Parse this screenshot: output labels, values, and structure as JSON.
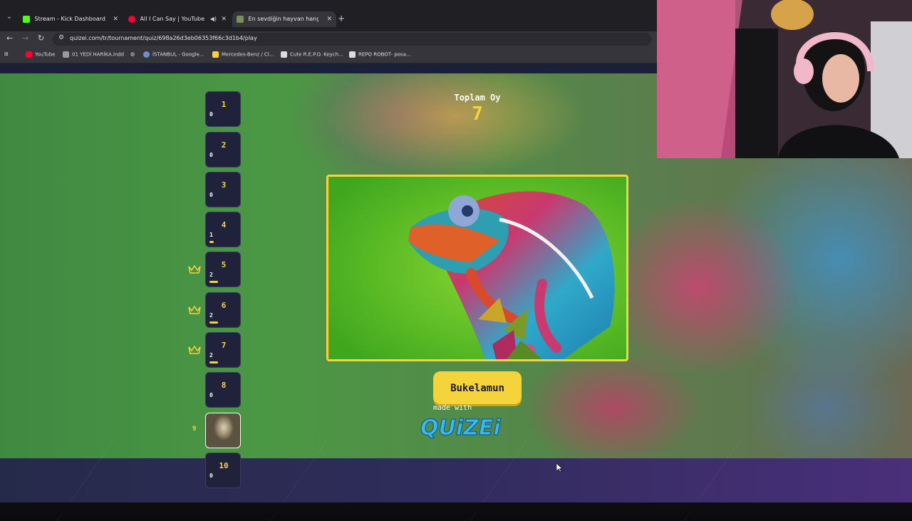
{
  "browser": {
    "tabs": [
      {
        "title": "Stream - Kick Dashboard",
        "favicon_color": "#53fc18",
        "active": false
      },
      {
        "title": "All I Can Say | YouTube Mu",
        "favicon_color": "#ff0033",
        "active": false
      },
      {
        "title": "En sevdiğin hayvan hangisi ?",
        "favicon_color": "#7a8f5a",
        "active": true
      }
    ],
    "url": "quizei.com/tr/tournament/quiz/698a26d3eb06353f66c3d1b4/play",
    "bookmarks": [
      {
        "label": "YouTube",
        "color": "#ff0033"
      },
      {
        "label": "01 YEDİ HARİKA.indd",
        "color": "#9a9a9a"
      },
      {
        "label": "İSTANBUL - Google...",
        "color": "#6a8fd0"
      },
      {
        "label": "Mercedes-Benz / Cl...",
        "color": "#f5d33a"
      },
      {
        "label": "Cute R.E.P.O. Keych...",
        "color": "#dddddd"
      },
      {
        "label": "REPO ROBOT- posa...",
        "color": "#dddddd"
      }
    ]
  },
  "quiz": {
    "total_votes_label": "Toplam Oy",
    "total_votes": "7",
    "answer": "Bukelamun",
    "made_with": "made with",
    "brand": "QUiZEi",
    "slots": [
      {
        "num": "1",
        "count": "0",
        "share": 0,
        "crown": false
      },
      {
        "num": "2",
        "count": "0",
        "share": 0,
        "crown": false
      },
      {
        "num": "3",
        "count": "0",
        "share": 0,
        "crown": false
      },
      {
        "num": "4",
        "count": "1",
        "share": 0.14,
        "crown": false
      },
      {
        "num": "5",
        "count": "2",
        "share": 0.29,
        "crown": true
      },
      {
        "num": "6",
        "count": "2",
        "share": 0.29,
        "crown": true
      },
      {
        "num": "7",
        "count": "2",
        "share": 0.29,
        "crown": true
      },
      {
        "num": "8",
        "count": "0",
        "share": 0,
        "crown": false
      },
      {
        "num": "9",
        "count": "",
        "share": 0,
        "crown": false,
        "image": true
      },
      {
        "num": "10",
        "count": "0",
        "share": 0,
        "crown": false
      }
    ]
  },
  "colors": {
    "accent": "#f5d33a",
    "slot_bg": "#20223c"
  }
}
